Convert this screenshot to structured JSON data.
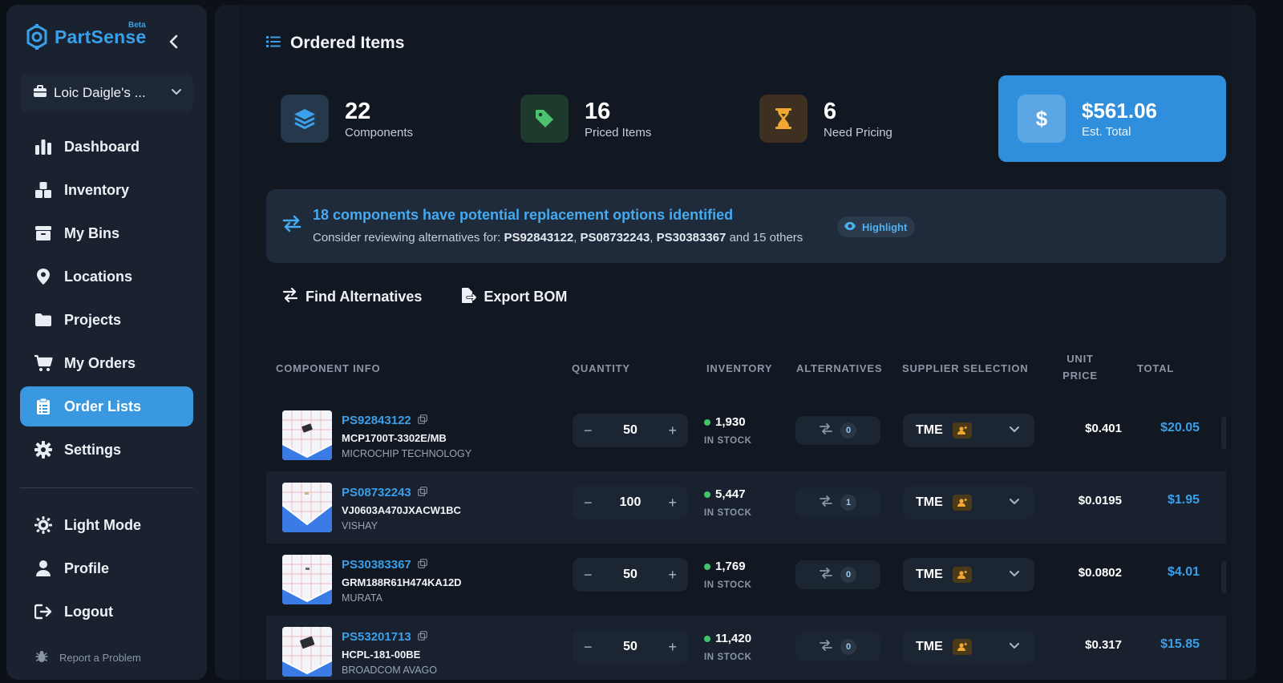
{
  "app": {
    "name": "PartSense",
    "beta": "Beta"
  },
  "workspace": {
    "label": "Loic Daigle's ..."
  },
  "nav": [
    {
      "label": "Dashboard",
      "icon": "bar-chart-icon"
    },
    {
      "label": "Inventory",
      "icon": "boxes-icon"
    },
    {
      "label": "My Bins",
      "icon": "archive-icon"
    },
    {
      "label": "Locations",
      "icon": "map-pin-icon"
    },
    {
      "label": "Projects",
      "icon": "folder-icon"
    },
    {
      "label": "My Orders",
      "icon": "cart-icon"
    },
    {
      "label": "Order Lists",
      "icon": "clipboard-list-icon",
      "active": true
    },
    {
      "label": "Settings",
      "icon": "gear-icon"
    }
  ],
  "nav_bottom": [
    {
      "label": "Light Mode",
      "icon": "sun-icon"
    },
    {
      "label": "Profile",
      "icon": "user-icon"
    },
    {
      "label": "Logout",
      "icon": "logout-icon"
    }
  ],
  "report": {
    "label": "Report a Problem",
    "icon": "bug-icon"
  },
  "page": {
    "title": "Ordered Items"
  },
  "stats": [
    {
      "value": "22",
      "label": "Components",
      "icon": "layers-icon",
      "color": "#3aa0ea"
    },
    {
      "value": "16",
      "label": "Priced Items",
      "icon": "tag-icon",
      "color": "#4cc26e"
    },
    {
      "value": "6",
      "label": "Need Pricing",
      "icon": "hourglass-icon",
      "color": "#f0a832"
    }
  ],
  "total": {
    "value": "$561.06",
    "label": "Est. Total",
    "icon": "dollar-icon",
    "color": "#2f8fdc"
  },
  "banner": {
    "headline": "18 components have potential replacement options identified",
    "prefix": "Consider reviewing alternatives for:",
    "ids": [
      "PS92843122",
      "PS08732243",
      "PS30383367"
    ],
    "suffix": "and 15 others",
    "highlight_label": "Highlight"
  },
  "actions": {
    "find_alternatives": "Find Alternatives",
    "export_bom": "Export BOM"
  },
  "table": {
    "headers": {
      "component": "COMPONENT INFO",
      "quantity": "QUANTITY",
      "inventory": "INVENTORY",
      "alternatives": "ALTERNATIVES",
      "supplier": "SUPPLIER SELECTION",
      "unit_price_1": "UNIT",
      "unit_price_2": "PRICE",
      "total": "TOTAL"
    },
    "rows": [
      {
        "id": "PS92843122",
        "mpn": "MCP1700T-3302E/MB",
        "manufacturer": "MICROCHIP TECHNOLOGY",
        "qty": "50",
        "stock": "1,930",
        "stock_status": "IN STOCK",
        "alternatives": "0",
        "supplier": "TME",
        "unit_price": "$0.401",
        "total": "$20.05"
      },
      {
        "id": "PS08732243",
        "mpn": "VJ0603A470JXACW1BC",
        "manufacturer": "VISHAY",
        "qty": "100",
        "stock": "5,447",
        "stock_status": "IN STOCK",
        "alternatives": "1",
        "supplier": "TME",
        "unit_price": "$0.0195",
        "total": "$1.95"
      },
      {
        "id": "PS30383367",
        "mpn": "GRM188R61H474KA12D",
        "manufacturer": "MURATA",
        "qty": "50",
        "stock": "1,769",
        "stock_status": "IN STOCK",
        "alternatives": "0",
        "supplier": "TME",
        "unit_price": "$0.0802",
        "total": "$4.01"
      },
      {
        "id": "PS53201713",
        "mpn": "HCPL-181-00BE",
        "manufacturer": "BROADCOM AVAGO",
        "qty": "50",
        "stock": "11,420",
        "stock_status": "IN STOCK",
        "alternatives": "0",
        "supplier": "TME",
        "unit_price": "$0.317",
        "total": "$15.85"
      }
    ],
    "minus": "−",
    "plus": "+"
  }
}
